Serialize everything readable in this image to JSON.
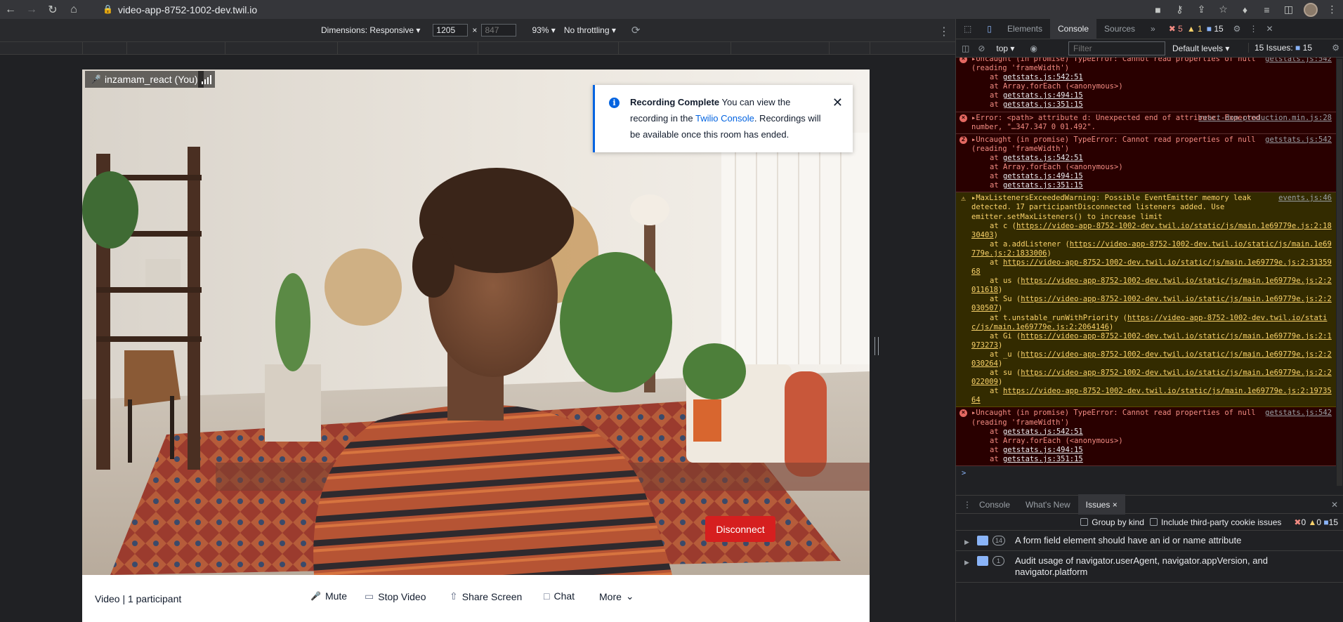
{
  "browser": {
    "url": "video-app-8752-1002-dev.twil.io",
    "icons": [
      "back-icon",
      "forward-icon",
      "reload-icon",
      "home-icon",
      "lock-icon",
      "camera-icon",
      "key-icon",
      "share-icon",
      "star-icon",
      "extensions-icon",
      "media-icon",
      "sidepanel-icon",
      "profile-avatar",
      "menu-icon"
    ]
  },
  "device_toolbar": {
    "dimensions_label": "Dimensions: Responsive",
    "width_value": "1205",
    "height_placeholder": "847",
    "times": "×",
    "zoom": "93%",
    "throttling": "No throttling"
  },
  "video": {
    "participant_name": "inzamam_react (You)",
    "toast": {
      "title": "Recording Complete",
      "text_before_link": " You can view the recording in the ",
      "link": "Twilio Console",
      "text_after_link": ". Recordings will be available once this room has ended."
    },
    "bottom": {
      "room_info": "Video | 1 participant",
      "mute": "Mute",
      "stop_video": "Stop Video",
      "share_screen": "Share Screen",
      "chat": "Chat",
      "more": "More",
      "disconnect": "Disconnect"
    }
  },
  "devtools": {
    "tabs": [
      "Elements",
      "Console",
      "Sources"
    ],
    "active_tab": "Console",
    "errors_count": "5",
    "warnings_count": "1",
    "issues_count": "15",
    "context": "top",
    "filter_placeholder": "Filter",
    "levels": "Default levels",
    "issues_label": "15 Issues:",
    "issues_badge": "15",
    "console_messages": [
      {
        "type": "err-partial",
        "header": "▸Uncaught (in promise) TypeError: Cannot read properties of null (reading 'frameWidth')",
        "source": "getstats.js:542",
        "stack": [
          [
            "at ",
            "getstats.js:542:51"
          ],
          [
            "at Array.forEach (<anonymous>)",
            ""
          ],
          [
            "at ",
            "getstats.js:494:15"
          ],
          [
            "at ",
            "getstats.js:351:15"
          ]
        ]
      },
      {
        "type": "err",
        "header": "▸Error: <path> attribute d: Unexpected end of attribute. Expected number, \"…347.347 0 01.492\".",
        "source": "react-dom.production.min.js:28",
        "stack": []
      },
      {
        "type": "err2",
        "count": "2",
        "header": "▸Uncaught (in promise) TypeError: Cannot read properties of null (reading 'frameWidth')",
        "source": "getstats.js:542",
        "stack": [
          [
            "at ",
            "getstats.js:542:51"
          ],
          [
            "at Array.forEach (<anonymous>)",
            ""
          ],
          [
            "at ",
            "getstats.js:494:15"
          ],
          [
            "at ",
            "getstats.js:351:15"
          ]
        ]
      },
      {
        "type": "warn",
        "header": "▸MaxListenersExceededWarning: Possible EventEmitter memory leak detected. 17 participantDisconnected listeners added. Use emitter.setMaxListeners() to increase limit",
        "source": "events.js:46",
        "stack": [
          [
            "at c (",
            "https://video-app-8752-1002-dev.twil.io/static/js/main.1e69779e.js:2:1830403",
            ")"
          ],
          [
            "at a.addListener (",
            "https://video-app-8752-1002-dev.twil.io/static/js/main.1e69779e.js:2:1833006",
            ")"
          ],
          [
            "at ",
            "https://video-app-8752-1002-dev.twil.io/static/js/main.1e69779e.js:2:3135968",
            ""
          ],
          [
            "at us (",
            "https://video-app-8752-1002-dev.twil.io/static/js/main.1e69779e.js:2:2011618",
            ")"
          ],
          [
            "at Su (",
            "https://video-app-8752-1002-dev.twil.io/static/js/main.1e69779e.js:2:2030507",
            ")"
          ],
          [
            "at t.unstable_runWithPriority (",
            "https://video-app-8752-1002-dev.twil.io/static/js/main.1e69779e.js:2:2064146",
            ")"
          ],
          [
            "at Gi (",
            "https://video-app-8752-1002-dev.twil.io/static/js/main.1e69779e.js:2:1973273",
            ")"
          ],
          [
            "at _u (",
            "https://video-app-8752-1002-dev.twil.io/static/js/main.1e69779e.js:2:2030264",
            ")"
          ],
          [
            "at su (",
            "https://video-app-8752-1002-dev.twil.io/static/js/main.1e69779e.js:2:2022009",
            ")"
          ],
          [
            "at ",
            "https://video-app-8752-1002-dev.twil.io/static/js/main.1e69779e.js:2:1973564",
            ""
          ]
        ]
      },
      {
        "type": "err",
        "header": "▸Uncaught (in promise) TypeError: Cannot read properties of null (reading 'frameWidth')",
        "source": "getstats.js:542",
        "stack": [
          [
            "at ",
            "getstats.js:542:51"
          ],
          [
            "at Array.forEach (<anonymous>)",
            ""
          ],
          [
            "at ",
            "getstats.js:494:15"
          ],
          [
            "at ",
            "getstats.js:351:15"
          ]
        ]
      }
    ],
    "prompt": ">",
    "drawer": {
      "tabs": [
        "Console",
        "What's New",
        "Issues"
      ],
      "active": "Issues",
      "group_by_kind": "Group by kind",
      "third_party": "Include third-party cookie issues",
      "counts": [
        "0",
        "0",
        "15"
      ],
      "issues": [
        {
          "count": "14",
          "text": "A form field element should have an id or name attribute"
        },
        {
          "count": "1",
          "text": "Audit usage of navigator.userAgent, navigator.appVersion, and navigator.platform"
        }
      ]
    }
  },
  "colors": {
    "accent": "#0263e0",
    "disconnect": "#d61f1f",
    "error": "#f28b82",
    "warning": "#f9d26b"
  }
}
